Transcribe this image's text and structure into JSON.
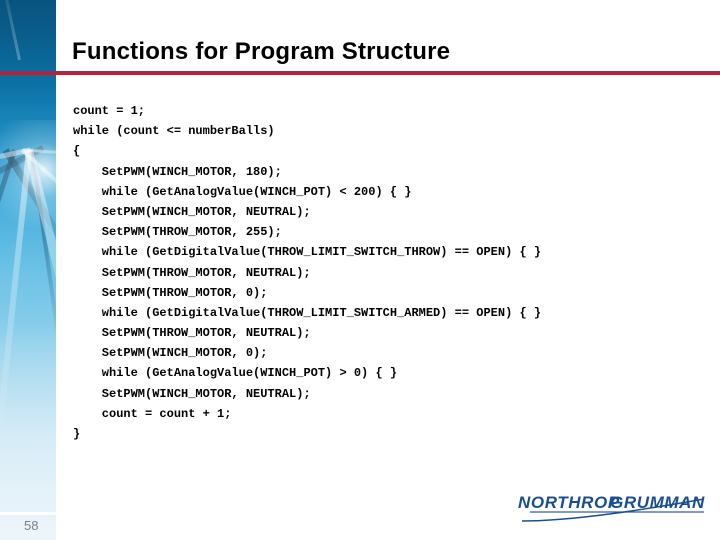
{
  "slide": {
    "title": "Functions for Program Structure",
    "number": "58",
    "accent_red": "#b5223b",
    "sidebar_blue": "#0d86be",
    "logo_blue": "#1a4f8f"
  },
  "code": {
    "language": "pseudocode",
    "lines": [
      "count = 1;",
      "while (count <= numberBalls)",
      "{",
      "    SetPWM(WINCH_MOTOR, 180);",
      "    while (GetAnalogValue(WINCH_POT) < 200) { }",
      "    SetPWM(WINCH_MOTOR, NEUTRAL);",
      "    SetPWM(THROW_MOTOR, 255);",
      "    while (GetDigitalValue(THROW_LIMIT_SWITCH_THROW) == OPEN) { }",
      "    SetPWM(THROW_MOTOR, NEUTRAL);",
      "    SetPWM(THROW_MOTOR, 0);",
      "    while (GetDigitalValue(THROW_LIMIT_SWITCH_ARMED) == OPEN) { }",
      "    SetPWM(THROW_MOTOR, NEUTRAL);",
      "    SetPWM(WINCH_MOTOR, 0);",
      "    while (GetAnalogValue(WINCH_POT) > 0) { }",
      "    SetPWM(WINCH_MOTOR, NEUTRAL);",
      "    count = count + 1;",
      "}"
    ]
  },
  "logo": {
    "word_one": "NORTHROP",
    "word_two": "GRUMMAN"
  }
}
